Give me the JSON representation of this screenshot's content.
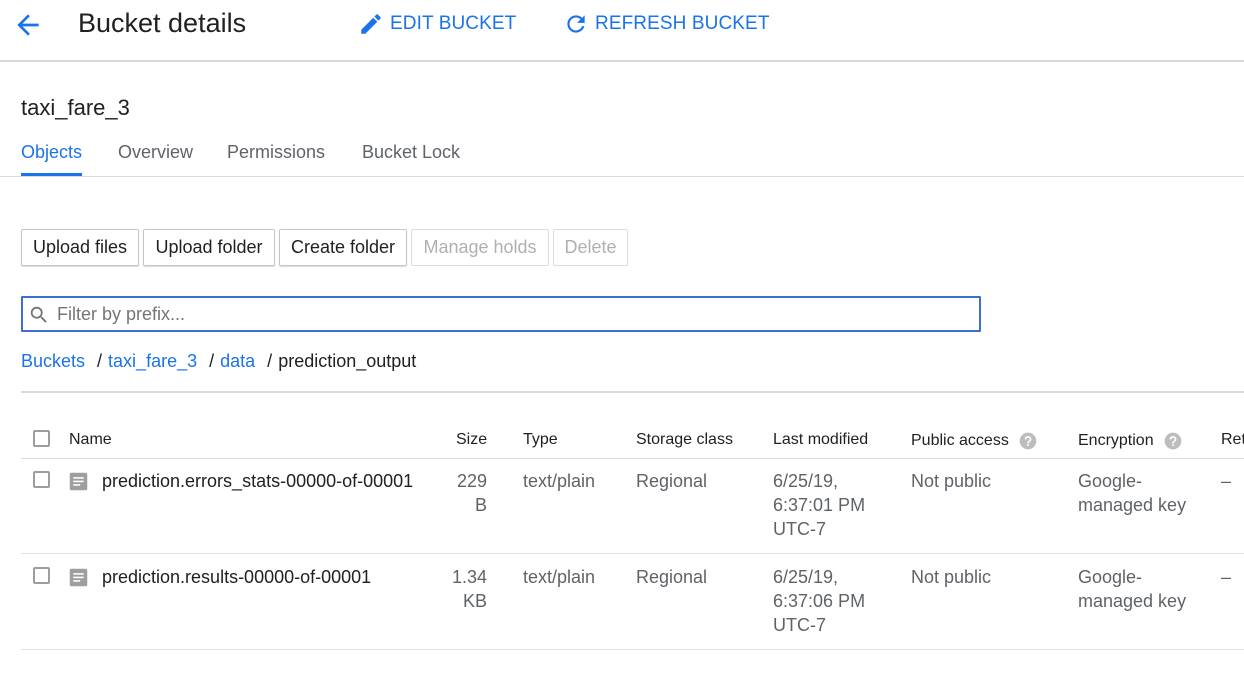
{
  "header": {
    "title": "Bucket details",
    "edit_label": "EDIT BUCKET",
    "refresh_label": "REFRESH BUCKET"
  },
  "bucket": {
    "name": "taxi_fare_3"
  },
  "tabs": [
    {
      "label": "Objects",
      "active": true
    },
    {
      "label": "Overview",
      "active": false
    },
    {
      "label": "Permissions",
      "active": false
    },
    {
      "label": "Bucket Lock",
      "active": false
    }
  ],
  "toolbar": {
    "upload_files": "Upload files",
    "upload_folder": "Upload folder",
    "create_folder": "Create folder",
    "manage_holds": "Manage holds",
    "delete": "Delete"
  },
  "filter": {
    "placeholder": "Filter by prefix..."
  },
  "breadcrumb": {
    "buckets": "Buckets",
    "bucket": "taxi_fare_3",
    "folder": "data",
    "current": "prediction_output",
    "sep": "/"
  },
  "table": {
    "columns": {
      "name": "Name",
      "size": "Size",
      "type": "Type",
      "storage_class": "Storage class",
      "last_modified": "Last modified",
      "public_access": "Public access",
      "encryption": "Encryption",
      "retention": "Ret"
    },
    "rows": [
      {
        "name": "prediction.errors_stats-00000-of-00001",
        "size_1": "229",
        "size_2": "B",
        "type": "text/plain",
        "storage_class": "Regional",
        "modified_1": "6/25/19,",
        "modified_2": "6:37:01 PM",
        "modified_3": "UTC-7",
        "public_access": "Not public",
        "encryption_1": "Google-",
        "encryption_2": "managed key",
        "retention": "–"
      },
      {
        "name": "prediction.results-00000-of-00001",
        "size_1": "1.34",
        "size_2": "KB",
        "type": "text/plain",
        "storage_class": "Regional",
        "modified_1": "6/25/19,",
        "modified_2": "6:37:06 PM",
        "modified_3": "UTC-7",
        "public_access": "Not public",
        "encryption_1": "Google-",
        "encryption_2": "managed key",
        "retention": "–"
      }
    ]
  },
  "colors": {
    "accent": "#1a73e8",
    "divider": "#dadada",
    "muted": "#5f6368"
  },
  "icons": [
    "arrow-back-icon",
    "pencil-icon",
    "refresh-icon",
    "search-icon",
    "help-icon",
    "file-icon"
  ]
}
